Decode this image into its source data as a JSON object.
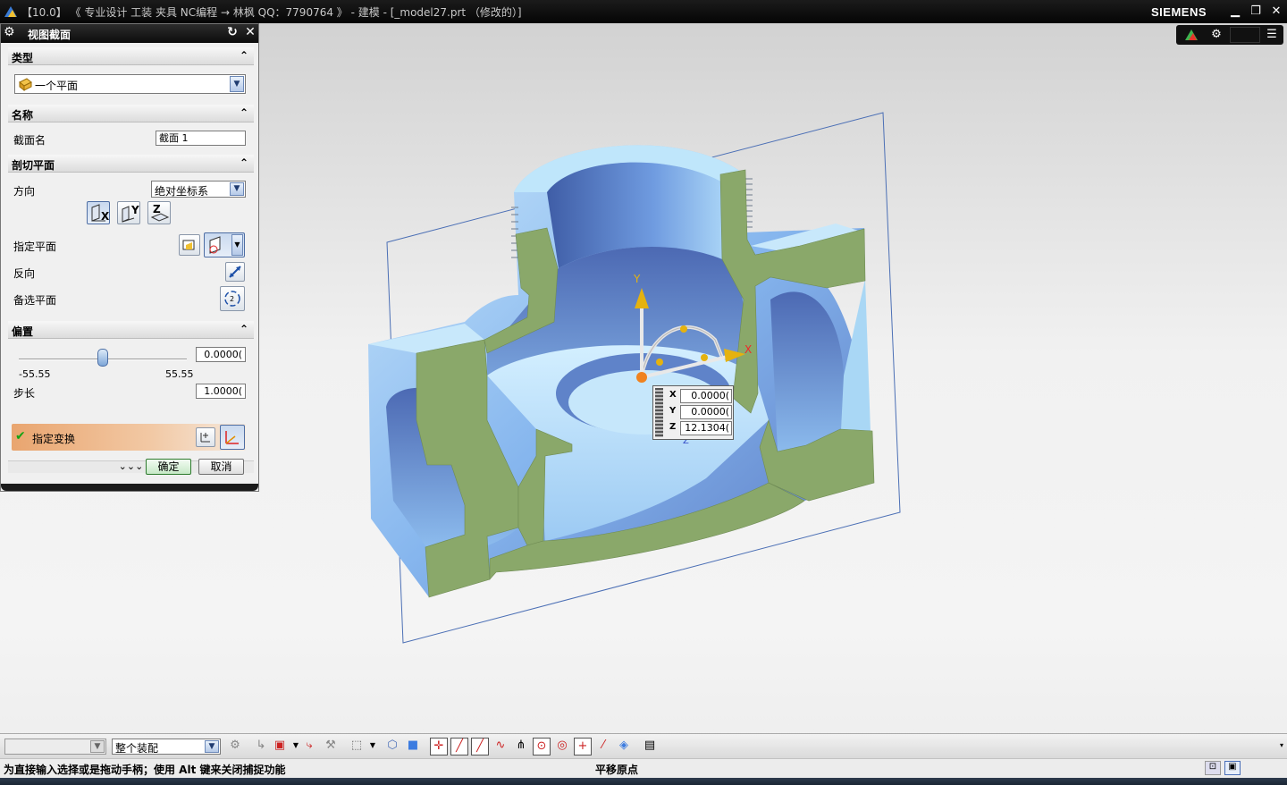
{
  "window": {
    "title": "【10.0】 《 专业设计 工装 夹具 NC编程 → 林枫 QQ：7790764 》 - 建模 - [_model27.prt （修改的）]",
    "brand": "SIEMENS",
    "minimize": "▁",
    "restore": "❐",
    "close": "✕"
  },
  "dialog": {
    "title": "视图截面",
    "type_section": {
      "header": "类型",
      "selected": "一个平面"
    },
    "name_section": {
      "header": "名称",
      "label": "截面名",
      "value": "截面 1"
    },
    "plane_section": {
      "header": "剖切平面",
      "orientation_label": "方向",
      "orientation_value": "绝对坐标系",
      "axis_x": "X",
      "axis_y": "Y",
      "axis_z": "Z",
      "specify_plane_label": "指定平面",
      "reverse_label": "反向",
      "alternate_label": "备选平面"
    },
    "offset_section": {
      "header": "偏置",
      "value": "0.0000(",
      "min": "-55.55",
      "max": "55.55",
      "slider_fraction": 0.5,
      "step_label": "步长",
      "step_value": "1.0000(",
      "transform_label": "指定变换"
    },
    "more": "⌄⌄⌄",
    "ok": "确定",
    "cancel": "取消"
  },
  "viewport": {
    "axis_x": "X",
    "axis_y": "Y",
    "axis_z": "Z",
    "coords": [
      {
        "axis": "X",
        "value": "0.0000("
      },
      {
        "axis": "Y",
        "value": "0.0000("
      },
      {
        "axis": "Z",
        "value": "12.1304("
      }
    ]
  },
  "toolbar": {
    "filter_value": "",
    "assembly_scope": "整个装配"
  },
  "status": {
    "prompt": "为直接输入选择或是拖动手柄；使用 Alt 键来关闭捕捉功能",
    "message": "平移原点"
  },
  "colors": {
    "section_fill": "#8aa86a",
    "model_light": "#a9d7f5",
    "model_dark": "#5a7fc6",
    "plane_outline": "#4b6fb5",
    "transform_highlight": "#e9a56f"
  }
}
